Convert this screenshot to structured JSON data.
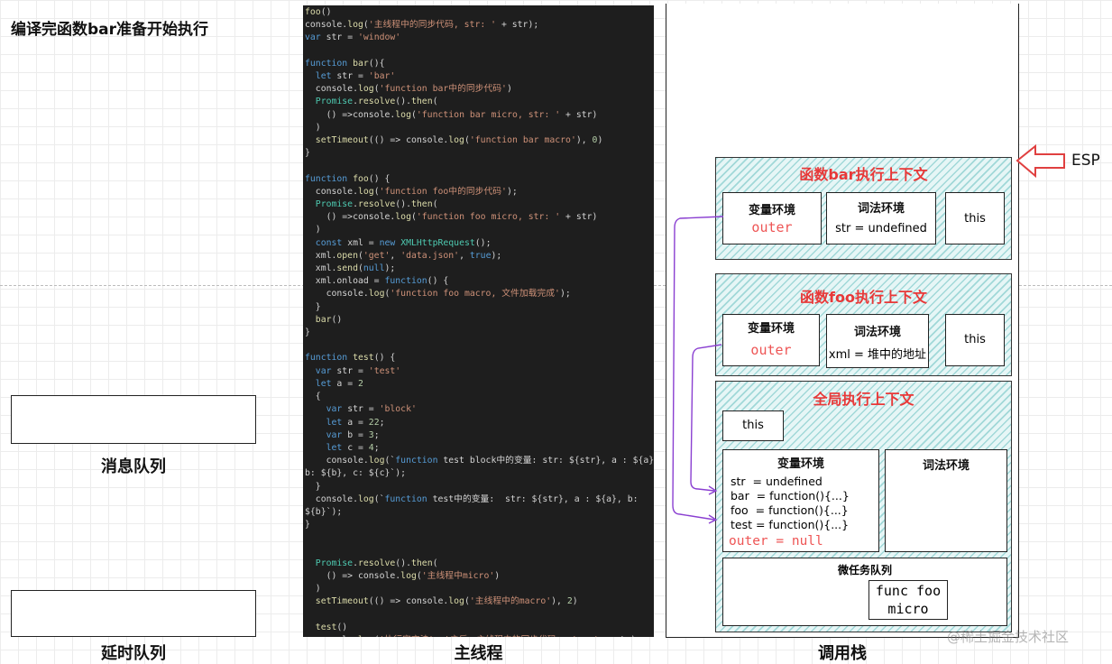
{
  "page_title": "编译完函数bar准备开始执行",
  "left": {
    "message_queue_label": "消息队列",
    "delay_queue_label": "延时队列"
  },
  "main_thread_label": "主线程",
  "call_stack_label": "调用栈",
  "esp_label": "ESP",
  "watermark": "@稀土掘金技术社区",
  "code_lines": [
    "foo()",
    "console.log('主线程中的同步代码, str: ' + str);",
    "var str = 'window'",
    "",
    "function bar(){",
    "  let str = 'bar'",
    "  console.log('function bar中的同步代码')",
    "  Promise.resolve().then(",
    "    () =>console.log('function bar micro, str: ' + str)",
    "  )",
    "  setTimeout(() => console.log('function bar macro'), 0)",
    "}",
    "",
    "function foo() {",
    "  console.log('function foo中的同步代码');",
    "  Promise.resolve().then(",
    "    () =>console.log('function foo micro, str: ' + str)",
    "  )",
    "  const xml = new XMLHttpRequest();",
    "  xml.open('get', 'data.json', true);",
    "  xml.send(null);",
    "  xml.onload = function() {",
    "    console.log('function foo macro, 文件加载完成');",
    "  }",
    "  bar()",
    "}",
    "",
    "function test() {",
    "  var str = 'test'",
    "  let a = 2",
    "  {",
    "    var str = 'block'",
    "    let a = 22;",
    "    var b = 3;",
    "    let c = 4;",
    "    console.log(`function test block中的变量: str: ${str}, a : ${a},",
    "b: ${b}, c: ${c}`);",
    "  }",
    "  console.log(`function test中的变量:  str: ${str}, a : ${a}, b:",
    "${b}`);",
    "}",
    "",
    "",
    "  Promise.resolve().then(",
    "    () => console.log('主线程中micro')",
    "  )",
    "  setTimeout(() => console.log('主线程中的macro'), 2)",
    "",
    "  test()",
    "  console.log('执行完方法test之后，主线程中的同步代码, str: ' + str);"
  ],
  "bar_ctx": {
    "title": "函数bar执行上下文",
    "var_env_title": "变量环境",
    "var_env_outer": "outer",
    "lex_env_title": "词法环境",
    "lex_env_value": "str = undefined",
    "this_label": "this"
  },
  "foo_ctx": {
    "title": "函数foo执行上下文",
    "var_env_title": "变量环境",
    "var_env_outer": "outer",
    "lex_env_title": "词法环境",
    "lex_env_value": "xml = 堆中的地址",
    "this_label": "this"
  },
  "global_ctx": {
    "title": "全局执行上下文",
    "this_label": "this",
    "var_env_title": "变量环境",
    "var_env_items": [
      "str  = undefined",
      "bar  = function(){...}",
      "foo  = function(){...}",
      "test = function(){...}"
    ],
    "var_env_outer": "outer = null",
    "lex_env_title": "词法环境",
    "microtask_title": "微任务队列",
    "microtask_item_line1": "func foo",
    "microtask_item_line2": "micro"
  },
  "colors": {
    "context_title": "#e83838",
    "arrow": "#8a3fd1",
    "code_bg": "#1e1e1e"
  }
}
